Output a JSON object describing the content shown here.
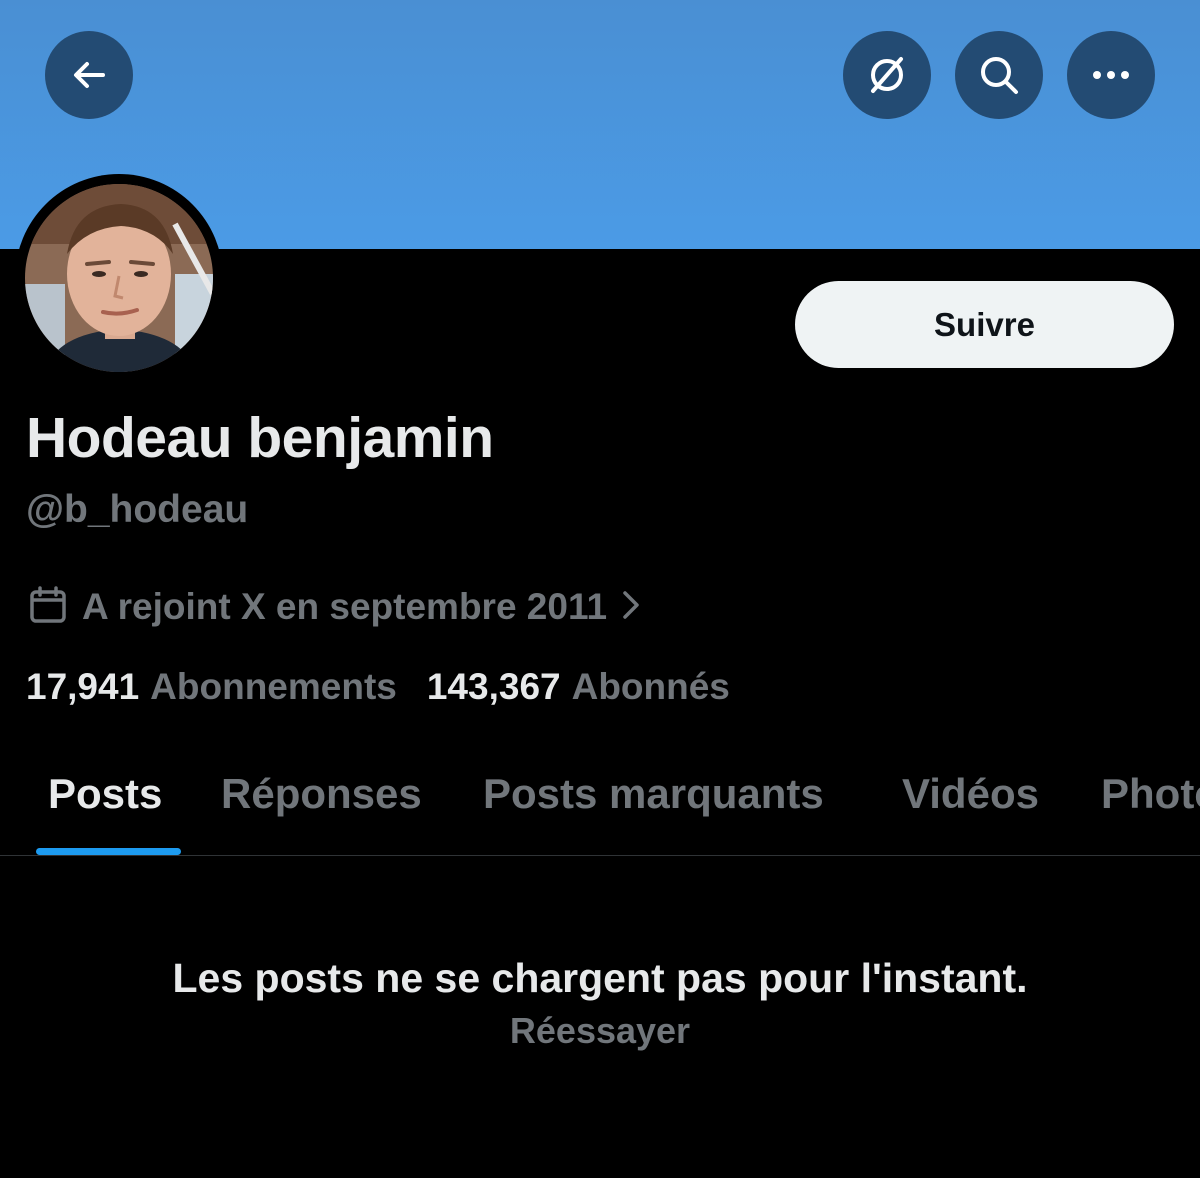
{
  "header": {
    "back_icon": "arrow-left-icon",
    "grok_icon": "grok-icon",
    "search_icon": "search-icon",
    "more_icon": "more-horizontal-icon",
    "banner_color": "#4b9be6",
    "button_color": "#234b73"
  },
  "profile": {
    "follow_label": "Suivre",
    "display_name": "Hodeau benjamin",
    "handle": "@b_hodeau",
    "joined_icon": "calendar-icon",
    "joined_text": "A rejoint X en septembre 2011",
    "following_count": "17,941",
    "following_label": "Abonnements",
    "followers_count": "143,367",
    "followers_label": "Abonnés"
  },
  "tabs": [
    {
      "label": "Posts",
      "active": true
    },
    {
      "label": "Réponses",
      "active": false
    },
    {
      "label": "Posts marquants",
      "active": false
    },
    {
      "label": "Vidéos",
      "active": false
    },
    {
      "label": "Photos",
      "active": false
    }
  ],
  "feed": {
    "empty_message": "Les posts ne se chargent pas pour l'instant.",
    "retry_label": "Réessayer"
  },
  "colors": {
    "accent": "#1d9bf0",
    "text_primary": "#e7e9ea",
    "text_secondary": "#71767b",
    "background": "#000000"
  }
}
